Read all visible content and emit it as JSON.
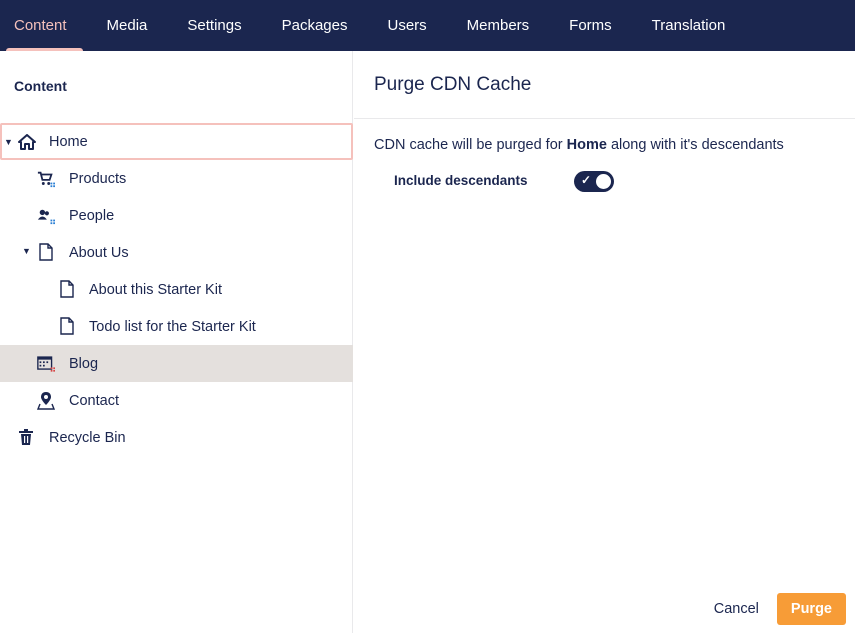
{
  "topnav": {
    "tabs": [
      {
        "label": "Content",
        "active": true
      },
      {
        "label": "Media"
      },
      {
        "label": "Settings"
      },
      {
        "label": "Packages"
      },
      {
        "label": "Users"
      },
      {
        "label": "Members"
      },
      {
        "label": "Forms"
      },
      {
        "label": "Translation"
      }
    ]
  },
  "sidebar": {
    "title": "Content",
    "tree": [
      {
        "label": "Home",
        "icon": "home-icon",
        "expanded": true
      },
      {
        "label": "Products",
        "icon": "shopping-cart-icon"
      },
      {
        "label": "People",
        "icon": "people-icon"
      },
      {
        "label": "About Us",
        "icon": "document-icon",
        "expanded": true
      },
      {
        "label": "About this Starter Kit",
        "icon": "document-icon"
      },
      {
        "label": "Todo list for the Starter Kit",
        "icon": "document-icon"
      },
      {
        "label": "Blog",
        "icon": "calendar-icon",
        "selected": true
      },
      {
        "label": "Contact",
        "icon": "map-pin-icon"
      },
      {
        "label": "Recycle Bin",
        "icon": "trash-icon"
      }
    ]
  },
  "panel": {
    "title": "Purge CDN Cache",
    "description_prefix": "CDN cache will be purged for ",
    "description_node": "Home",
    "description_suffix": " along with it's descendants",
    "include_descendants_label": "Include descendants",
    "include_descendants_checked": true,
    "cancel_label": "Cancel",
    "purge_label": "Purge"
  },
  "colors": {
    "nav_bg": "#1b264f",
    "accent": "#f5c1bc",
    "purge_button": "#f79c37",
    "selected_row": "#e4e0dd"
  }
}
